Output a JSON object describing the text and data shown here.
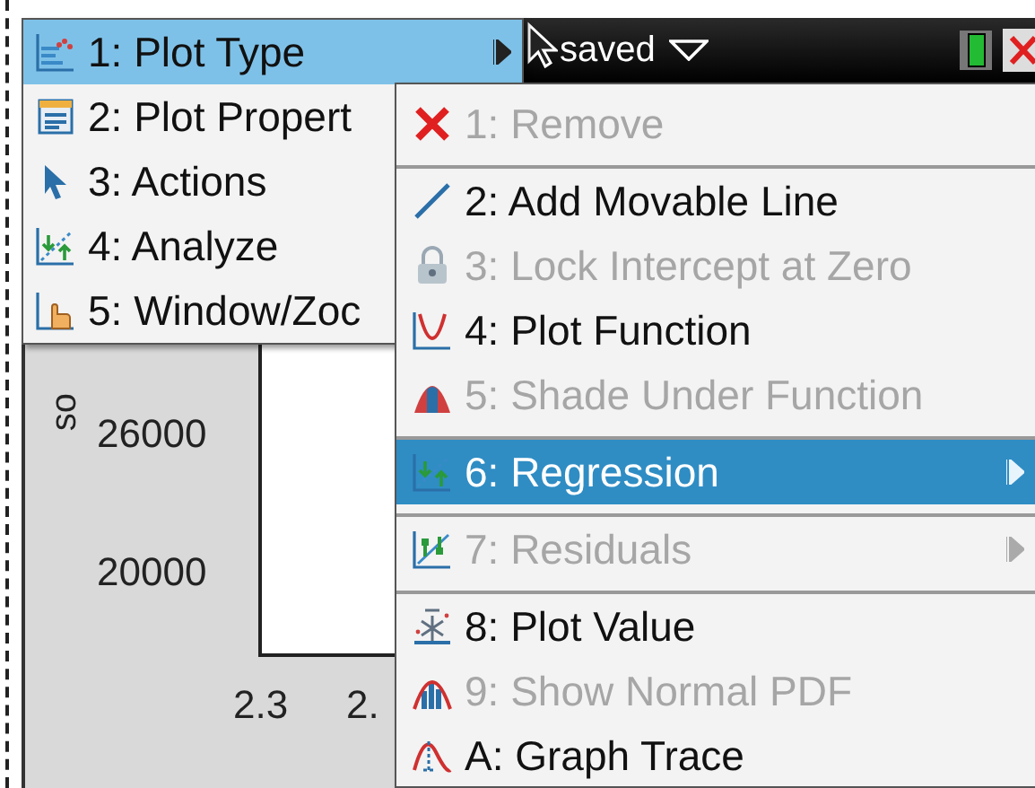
{
  "top_bar": {
    "document_status": "saved"
  },
  "menu": [
    {
      "label": "1: Plot Type",
      "selected": true
    },
    {
      "label": "2: Plot Propert",
      "selected": false
    },
    {
      "label": "3: Actions",
      "selected": false
    },
    {
      "label": "4: Analyze",
      "selected": false
    },
    {
      "label": "5: Window/Zoc",
      "selected": false
    }
  ],
  "submenu": [
    {
      "label": "1: Remove",
      "disabled": true,
      "selected": false,
      "has_submenu": false,
      "separator_before": false
    },
    {
      "label": "2: Add Movable Line",
      "disabled": false,
      "selected": false,
      "has_submenu": false,
      "separator_before": true
    },
    {
      "label": "3: Lock Intercept at Zero",
      "disabled": true,
      "selected": false,
      "has_submenu": false,
      "separator_before": false
    },
    {
      "label": "4: Plot Function",
      "disabled": false,
      "selected": false,
      "has_submenu": false,
      "separator_before": false
    },
    {
      "label": "5: Shade Under Function",
      "disabled": true,
      "selected": false,
      "has_submenu": false,
      "separator_before": false
    },
    {
      "label": "6: Regression",
      "disabled": false,
      "selected": true,
      "has_submenu": true,
      "separator_before": true
    },
    {
      "label": "7: Residuals",
      "disabled": true,
      "selected": false,
      "has_submenu": true,
      "separator_before": true
    },
    {
      "label": "8: Plot Value",
      "disabled": false,
      "selected": false,
      "has_submenu": false,
      "separator_before": true
    },
    {
      "label": "9: Show Normal PDF",
      "disabled": true,
      "selected": false,
      "has_submenu": false,
      "separator_before": false
    },
    {
      "label": "A: Graph Trace",
      "disabled": false,
      "selected": false,
      "has_submenu": false,
      "separator_before": false
    }
  ],
  "graph": {
    "y_axis_label": "so",
    "y_ticks": [
      "26000",
      "20000"
    ],
    "x_ticks": [
      "2.3",
      "2."
    ]
  }
}
